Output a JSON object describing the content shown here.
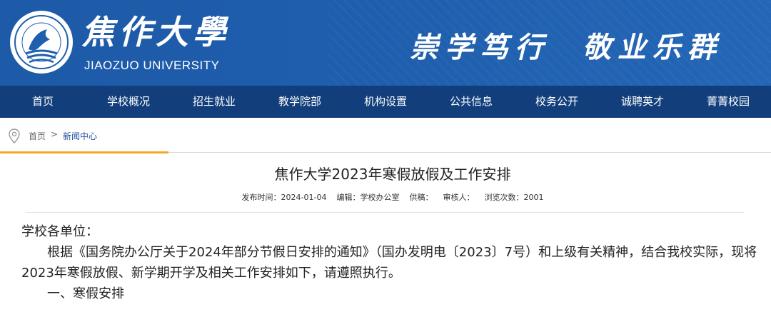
{
  "header": {
    "logo_icon": "university-seal-icon",
    "name_cn": "焦作大學",
    "name_en": "JIAOZUO UNIVERSITY",
    "motto": "崇学笃行  敬业乐群",
    "bg_color": "#1f5fae"
  },
  "nav": {
    "bg_color": "#123f7c",
    "items": [
      "首页",
      "学校概况",
      "招生就业",
      "教学院部",
      "机构设置",
      "公共信息",
      "校务公开",
      "诚聘英才",
      "菁菁校园"
    ]
  },
  "breadcrumb": {
    "icon": "location-pin-icon",
    "home": "首页",
    "separator": ">",
    "current": "新闻中心",
    "accent_color": "#f5a623"
  },
  "article": {
    "title": "焦作大学2023年寒假放假及工作安排",
    "meta": {
      "date": "发布时间：2024-01-04",
      "editor": "编辑：学校办公室",
      "source": "供稿：",
      "reviewer": "审核人：",
      "views": "浏览次数：2001"
    },
    "greeting": "学校各单位：",
    "paragraph": "根据《国务院办公厅关于2024年部分节假日安排的通知》（国办发明电〔2023〕7号）和上级有关精神，结合我校实际，现将2023年寒假放假、新学期开学及相关工作安排如下，请遵照执行。",
    "section1": "一、寒假安排"
  }
}
